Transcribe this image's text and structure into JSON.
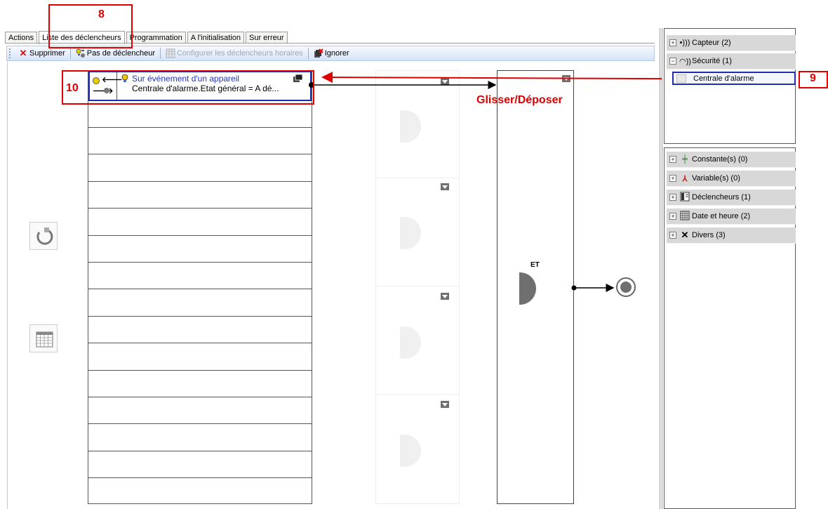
{
  "tabs": [
    {
      "label": "Actions",
      "active": false
    },
    {
      "label": "Liste des déclencheurs",
      "active": true
    },
    {
      "label": "Programmation",
      "active": false
    },
    {
      "label": "A l'initialisation",
      "active": false
    },
    {
      "label": "Sur erreur",
      "active": false
    }
  ],
  "toolbar": {
    "delete_label": "Supprimer",
    "no_trigger_label": "Pas de déclencheur",
    "configure_time_label": "Configurer les déclencheurs horaires",
    "ignore_label": "Ignorer"
  },
  "trigger": {
    "title": "Sur événement d'un appareil",
    "detail": "Centrale d'alarme.Etat général = A dé..."
  },
  "logic": {
    "and_label": "ET"
  },
  "tree": {
    "items": [
      {
        "label": "Capteur (2)",
        "expander": "+",
        "icon": "sensor-icon"
      },
      {
        "label": "Sécurité (1)",
        "expander": "−",
        "icon": "security-icon"
      }
    ],
    "selected_child": "Centrale d'alarme"
  },
  "palette": {
    "items": [
      {
        "label": "Constante(s) (0)",
        "icon": "constant-icon"
      },
      {
        "label": "Variable(s) (0)",
        "icon": "variable-icon"
      },
      {
        "label": "Déclencheurs (1)",
        "icon": "triggers-icon"
      },
      {
        "label": "Date et heure (2)",
        "icon": "calendar-icon"
      },
      {
        "label": "Divers (3)",
        "icon": "tools-icon"
      }
    ]
  },
  "annotations": {
    "n8": "8",
    "n9": "9",
    "n10": "10",
    "drag_drop": "Glisser/Déposer"
  },
  "colors": {
    "annotation": "#e00000",
    "selection": "#1b2fb0",
    "link_text": "#1f35c4",
    "gate": "#6f6f6f"
  }
}
